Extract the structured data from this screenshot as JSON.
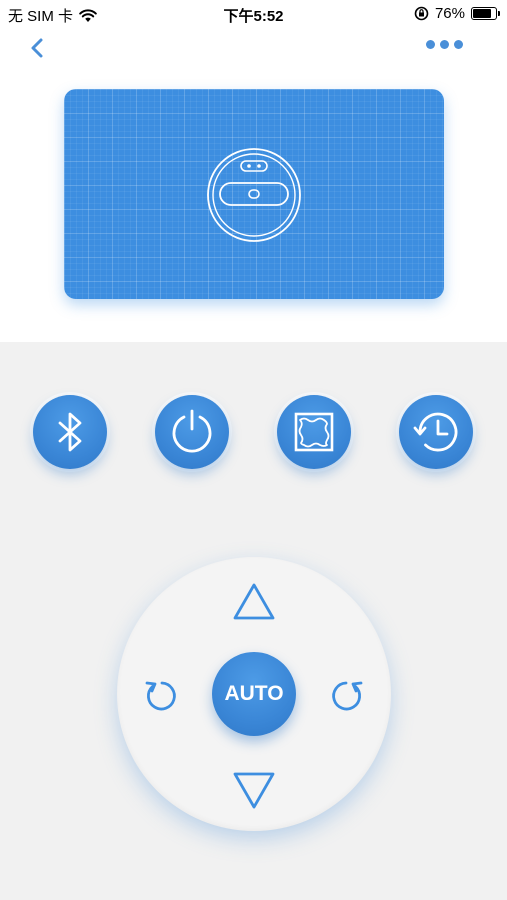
{
  "status_bar": {
    "carrier": "无 SIM 卡",
    "time": "下午5:52",
    "battery_percent": "76%",
    "battery_level": 0.76
  },
  "nav": {
    "back_icon": "chevron-left-icon",
    "more_icon": "more-dots-icon"
  },
  "map": {
    "robot_icon": "robot-vacuum-icon"
  },
  "function_buttons": [
    {
      "name": "bluetooth-button",
      "icon": "bluetooth-icon"
    },
    {
      "name": "power-button",
      "icon": "power-icon"
    },
    {
      "name": "edge-clean-button",
      "icon": "edge-clean-icon"
    },
    {
      "name": "schedule-button",
      "icon": "history-clock-icon"
    }
  ],
  "dpad": {
    "center_label": "AUTO",
    "up_icon": "triangle-up-icon",
    "down_icon": "triangle-down-icon",
    "rotate_left_icon": "rotate-left-icon",
    "rotate_right_icon": "rotate-right-icon"
  },
  "colors": {
    "accent": "#3d8ee0",
    "panel_bg": "#f1f1f1"
  }
}
